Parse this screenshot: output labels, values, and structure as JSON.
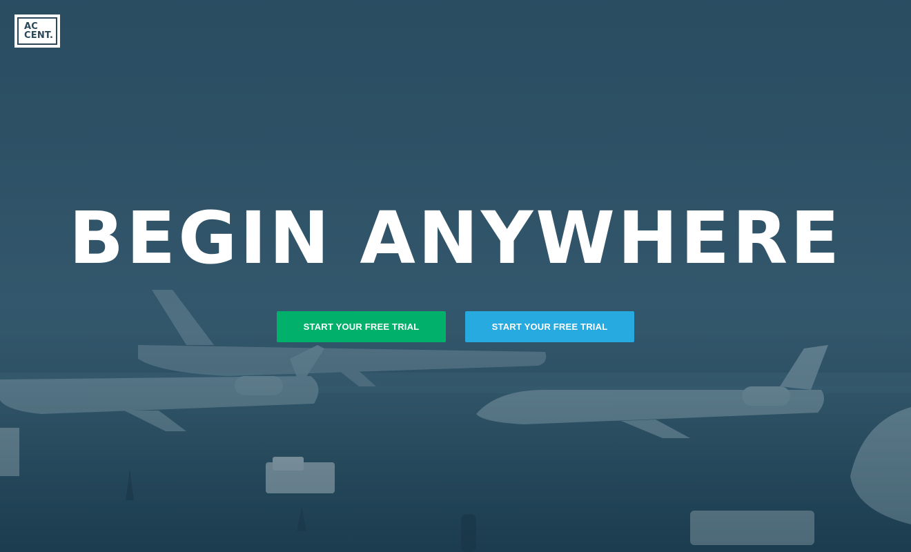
{
  "brand": {
    "logo_line1": "AC",
    "logo_line2": "CENT."
  },
  "hero": {
    "headline": "BEGIN ANYWHERE",
    "buttons": [
      {
        "label": "START YOUR FREE TRIAL",
        "color": "#00b06b"
      },
      {
        "label": "START YOUR FREE TRIAL",
        "color": "#27aae0"
      }
    ],
    "background_subject": "airport-tarmac-with-jets"
  },
  "colors": {
    "overlay": "#2f4d5f",
    "logo_ink": "#2a4859"
  }
}
